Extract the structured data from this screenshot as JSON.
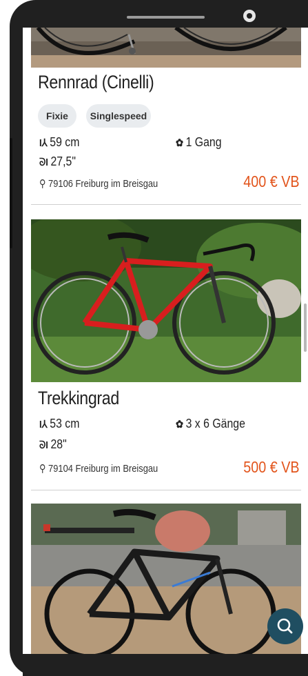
{
  "listings": [
    {
      "title": "Rennrad (Cinelli)",
      "tags": [
        "Fixie",
        "Singlespeed"
      ],
      "frame_size": "59 cm",
      "gears": "1 Gang",
      "wheel_size": "27,5\"",
      "location": "79106 Freiburg im Breisgau",
      "price": "400 € VB"
    },
    {
      "title": "Trekkingrad",
      "frame_size": "53 cm",
      "gears": "3 x 6 Gänge",
      "wheel_size": "28\"",
      "location": "79104 Freiburg im Breisgau",
      "price": "500 € VB"
    }
  ],
  "icons": {
    "frame": "frame-size-icon",
    "wheel": "wheel-size-icon",
    "gear": "gear-icon",
    "location": "location-pin-icon",
    "search": "search-icon"
  },
  "colors": {
    "price": "#e2541b",
    "fab": "#1f4e61",
    "tag_bg": "#e9ecef"
  }
}
